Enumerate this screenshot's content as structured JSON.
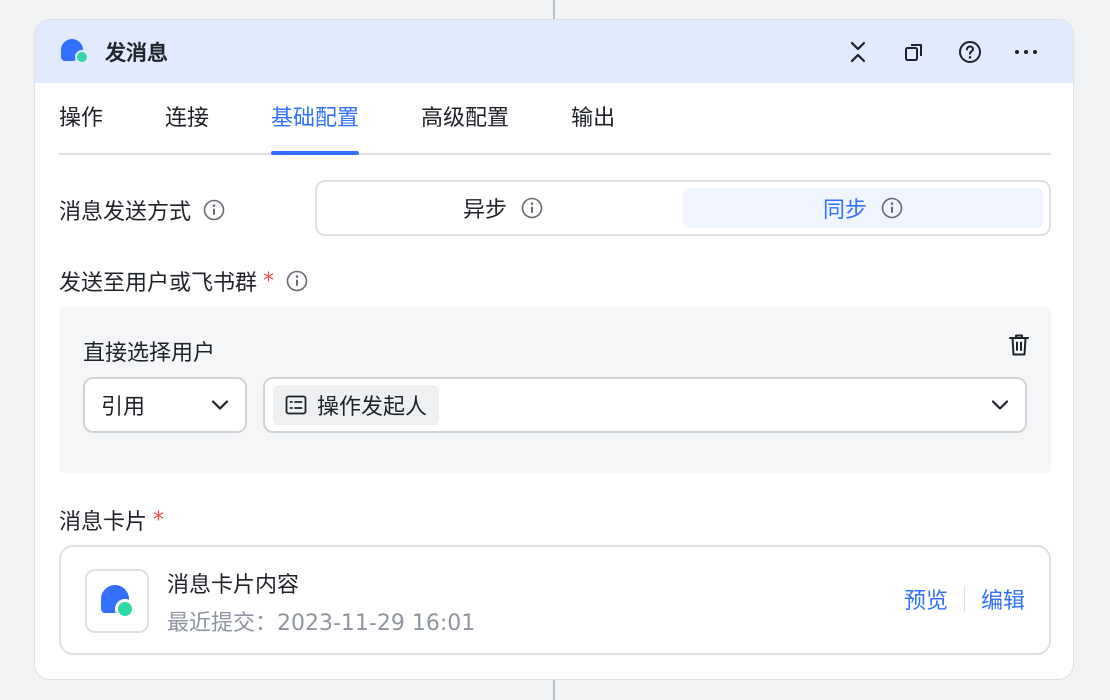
{
  "header": {
    "title": "发消息"
  },
  "tabs": [
    {
      "label": "操作"
    },
    {
      "label": "连接"
    },
    {
      "label": "基础配置",
      "active": true
    },
    {
      "label": "高级配置"
    },
    {
      "label": "输出"
    }
  ],
  "send_mode": {
    "label": "消息发送方式",
    "options": [
      "异步",
      "同步"
    ],
    "selected": "同步"
  },
  "recipient": {
    "label": "发送至用户或飞书群",
    "required_mark": "*",
    "box_title": "直接选择用户",
    "ref_select": "引用",
    "value_tag": "操作发起人"
  },
  "message_card": {
    "label": "消息卡片",
    "required_mark": "*",
    "title": "消息卡片内容",
    "subtitle": "最近提交：2023-11-29 16:01",
    "preview_label": "预览",
    "edit_label": "编辑"
  },
  "colors": {
    "accent": "#3370ff",
    "header_bg": "#e1eaff",
    "required": "#f54a45",
    "secondary_bubble": "#2ed8a8"
  },
  "icons": {
    "header": "message-bubble-icon",
    "actions": [
      "collapse-icon",
      "copy-icon",
      "help-icon",
      "more-icon"
    ]
  }
}
